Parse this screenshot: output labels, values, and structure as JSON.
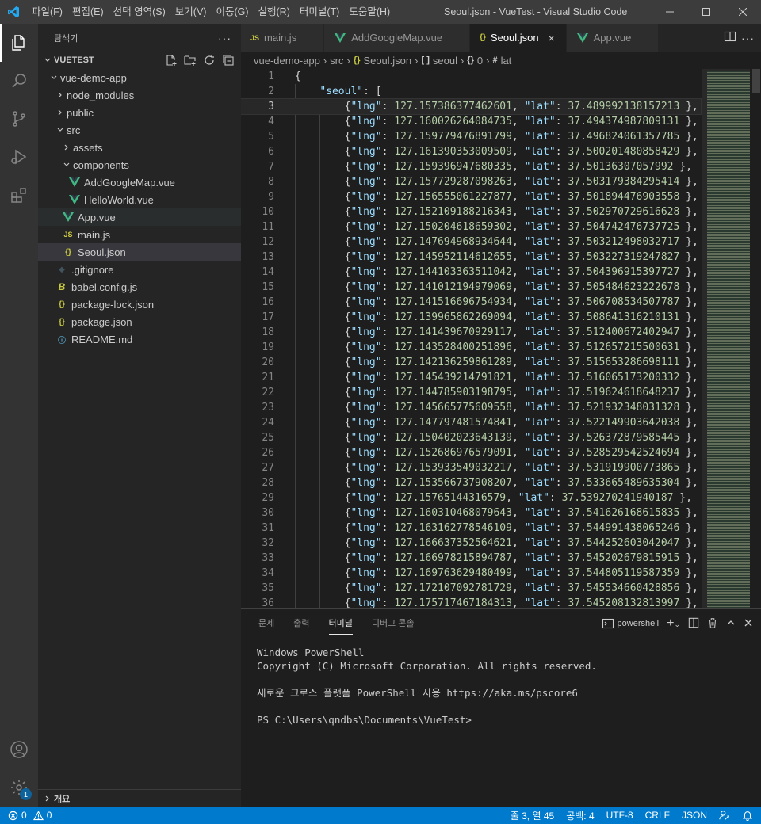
{
  "titlebar": {
    "menu": [
      "파일(F)",
      "편집(E)",
      "선택 영역(S)",
      "보기(V)",
      "이동(G)",
      "실행(R)",
      "터미널(T)",
      "도움말(H)"
    ],
    "title": "Seoul.json - VueTest - Visual Studio Code"
  },
  "sidebar": {
    "header": "탐색기",
    "section": "VUETEST",
    "tree": [
      {
        "label": "vue-demo-app",
        "depth": 1,
        "twisty": "open",
        "icon": ""
      },
      {
        "label": "node_modules",
        "depth": 2,
        "twisty": "closed",
        "icon": ""
      },
      {
        "label": "public",
        "depth": 2,
        "twisty": "closed",
        "icon": ""
      },
      {
        "label": "src",
        "depth": 2,
        "twisty": "open",
        "icon": ""
      },
      {
        "label": "assets",
        "depth": 3,
        "twisty": "closed",
        "icon": ""
      },
      {
        "label": "components",
        "depth": 3,
        "twisty": "open",
        "icon": ""
      },
      {
        "label": "AddGoogleMap.vue",
        "depth": 4,
        "twisty": "",
        "icon": "vue"
      },
      {
        "label": "HelloWorld.vue",
        "depth": 4,
        "twisty": "",
        "icon": "vue"
      },
      {
        "label": "App.vue",
        "depth": 3,
        "twisty": "",
        "icon": "vue",
        "state": "hover"
      },
      {
        "label": "main.js",
        "depth": 3,
        "twisty": "",
        "icon": "js"
      },
      {
        "label": "Seoul.json",
        "depth": 3,
        "twisty": "",
        "icon": "json",
        "state": "selected"
      },
      {
        "label": ".gitignore",
        "depth": 2,
        "twisty": "",
        "icon": "git"
      },
      {
        "label": "babel.config.js",
        "depth": 2,
        "twisty": "",
        "icon": "babel"
      },
      {
        "label": "package-lock.json",
        "depth": 2,
        "twisty": "",
        "icon": "json"
      },
      {
        "label": "package.json",
        "depth": 2,
        "twisty": "",
        "icon": "json"
      },
      {
        "label": "README.md",
        "depth": 2,
        "twisty": "",
        "icon": "info"
      }
    ],
    "outline": "개요"
  },
  "tabs": [
    {
      "label": "main.js",
      "icon": "js",
      "active": false
    },
    {
      "label": "AddGoogleMap.vue",
      "icon": "vue",
      "active": false
    },
    {
      "label": "Seoul.json",
      "icon": "json",
      "active": true
    },
    {
      "label": "App.vue",
      "icon": "vue",
      "active": false
    }
  ],
  "breadcrumbs": [
    "vue-demo-app",
    "src",
    "Seoul.json",
    "seoul",
    "0",
    "lat"
  ],
  "editor": {
    "current_line": 3,
    "lines": [
      {
        "n": 1,
        "type": "open"
      },
      {
        "n": 2,
        "type": "key"
      },
      {
        "n": 3,
        "lng": "127.157386377462601",
        "lat": "37.489992138157213"
      },
      {
        "n": 4,
        "lng": "127.160026264084735",
        "lat": "37.494374987809131"
      },
      {
        "n": 5,
        "lng": "127.159779476891799",
        "lat": "37.496824061357785"
      },
      {
        "n": 6,
        "lng": "127.161390353009509",
        "lat": "37.500201480858429"
      },
      {
        "n": 7,
        "lng": "127.159396947680335",
        "lat": "37.50136307057992"
      },
      {
        "n": 8,
        "lng": "127.157729287098263",
        "lat": "37.503179384295414"
      },
      {
        "n": 9,
        "lng": "127.156555061227877",
        "lat": "37.501894476903558"
      },
      {
        "n": 10,
        "lng": "127.152109188216343",
        "lat": "37.502970729616628"
      },
      {
        "n": 11,
        "lng": "127.150204618659302",
        "lat": "37.504742476737725"
      },
      {
        "n": 12,
        "lng": "127.147694968934644",
        "lat": "37.503212498032717"
      },
      {
        "n": 13,
        "lng": "127.145952114612655",
        "lat": "37.503227319247827"
      },
      {
        "n": 14,
        "lng": "127.144103363511042",
        "lat": "37.504396915397727"
      },
      {
        "n": 15,
        "lng": "127.141012194979069",
        "lat": "37.505484623222678"
      },
      {
        "n": 16,
        "lng": "127.141516696754934",
        "lat": "37.506708534507787"
      },
      {
        "n": 17,
        "lng": "127.139965862269094",
        "lat": "37.508641316210131"
      },
      {
        "n": 18,
        "lng": "127.141439670929117",
        "lat": "37.512400672402947"
      },
      {
        "n": 19,
        "lng": "127.143528400251896",
        "lat": "37.512657215500631"
      },
      {
        "n": 20,
        "lng": "127.142136259861289",
        "lat": "37.515653286698111"
      },
      {
        "n": 21,
        "lng": "127.145439214791821",
        "lat": "37.516065173200332"
      },
      {
        "n": 22,
        "lng": "127.144785903198795",
        "lat": "37.519624618648237"
      },
      {
        "n": 23,
        "lng": "127.145665775609558",
        "lat": "37.521932348031328"
      },
      {
        "n": 24,
        "lng": "127.147797481574841",
        "lat": "37.522149903642038"
      },
      {
        "n": 25,
        "lng": "127.150402023643139",
        "lat": "37.526372879585445"
      },
      {
        "n": 26,
        "lng": "127.152686976579091",
        "lat": "37.528529542524694"
      },
      {
        "n": 27,
        "lng": "127.153933549032217",
        "lat": "37.531919900773865"
      },
      {
        "n": 28,
        "lng": "127.153566737908207",
        "lat": "37.533665489635304"
      },
      {
        "n": 29,
        "lng": "127.15765144316579",
        "lat": "37.539270241940187"
      },
      {
        "n": 30,
        "lng": "127.160310468079643",
        "lat": "37.541626168615835"
      },
      {
        "n": 31,
        "lng": "127.163162778546109",
        "lat": "37.544991438065246"
      },
      {
        "n": 32,
        "lng": "127.166637352564621",
        "lat": "37.544252603042047"
      },
      {
        "n": 33,
        "lng": "127.166978215894787",
        "lat": "37.545202679815915"
      },
      {
        "n": 34,
        "lng": "127.169763629480499",
        "lat": "37.544805119587359"
      },
      {
        "n": 35,
        "lng": "127.172107092781729",
        "lat": "37.545534660428856"
      },
      {
        "n": 36,
        "lng": "127.175717467184313",
        "lat": "37.545208132813997"
      }
    ]
  },
  "panel": {
    "tabs": [
      "문제",
      "출력",
      "터미널",
      "디버그 콘솔"
    ],
    "active_tab": "터미널",
    "shell": "powershell",
    "terminal_lines": [
      "Windows PowerShell",
      "Copyright (C) Microsoft Corporation. All rights reserved.",
      "",
      "새로운 크로스 플랫폼 PowerShell 사용 https://aka.ms/pscore6",
      "",
      "PS C:\\Users\\qndbs\\Documents\\VueTest>"
    ]
  },
  "statusbar": {
    "errors": "0",
    "warnings": "0",
    "position": "줄 3, 열 45",
    "spaces": "공백: 4",
    "encoding": "UTF-8",
    "eol": "CRLF",
    "language": "JSON"
  },
  "activity": {
    "settings_badge": "1"
  },
  "colors": {
    "accent": "#007acc",
    "vue": "#41b883",
    "json": "#cbcb41",
    "key": "#9cdcfe",
    "string": "#ce9178",
    "number": "#b5cea8"
  }
}
